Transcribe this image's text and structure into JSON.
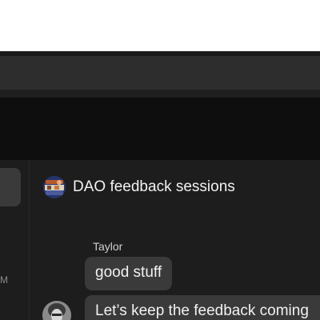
{
  "sidebar": {
    "time_fragment": "PM"
  },
  "chat": {
    "channel_title": "DAO feedback sessions",
    "channel_avatar_icon": "group-photo-avatar",
    "messages": [
      {
        "author": "Taylor",
        "text": "good stuff"
      },
      {
        "author": "",
        "text": "Let’s keep the feedback coming"
      }
    ],
    "user_avatar_icon": "person-photo-avatar"
  },
  "colors": {
    "app_background": "#1d1d1d",
    "header_background": "#0e0e0e",
    "bubble_background": "#3a3a3a",
    "text_primary": "#f2f2f2"
  }
}
